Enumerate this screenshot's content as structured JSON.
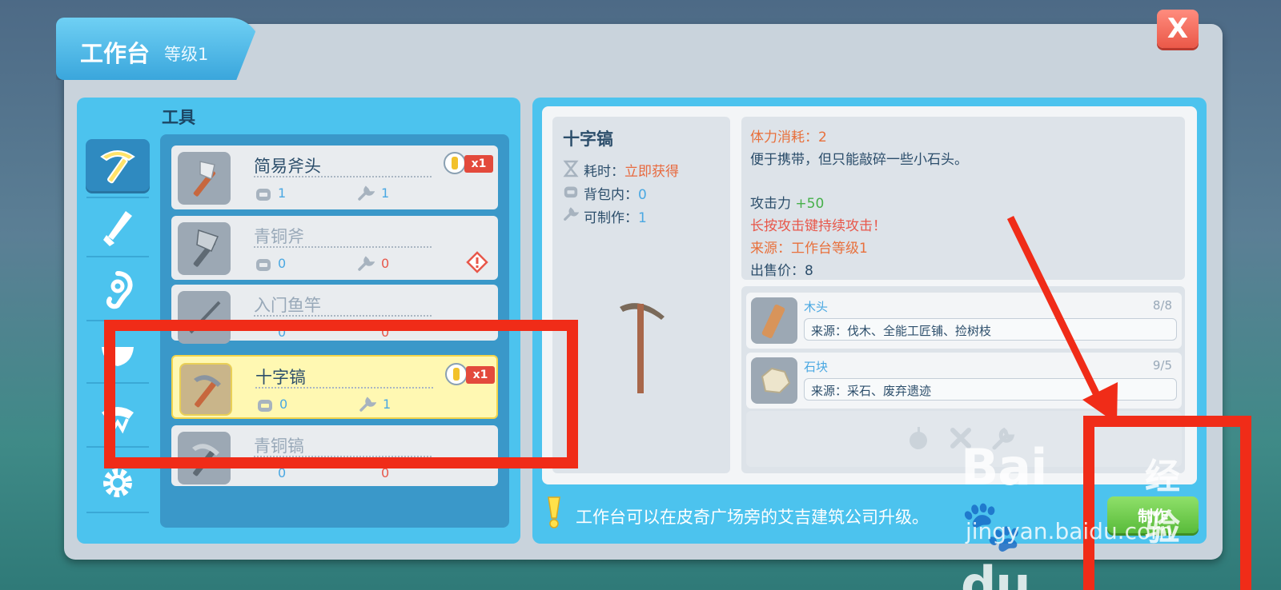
{
  "window": {
    "title": "工作台",
    "level": "等级1",
    "close_label": "X"
  },
  "category": {
    "label": "工具",
    "items": [
      {
        "icon": "pickaxe-icon",
        "active": true
      },
      {
        "icon": "sword-icon",
        "active": false
      },
      {
        "icon": "ear-icon",
        "active": false
      },
      {
        "icon": "bowl-icon",
        "active": false
      },
      {
        "icon": "ribbon-icon",
        "active": false
      },
      {
        "icon": "gear-icon",
        "active": false
      }
    ]
  },
  "tool_list": [
    {
      "name": "简易斧头",
      "bag": "1",
      "craftable": "1",
      "new": true,
      "count": "x1",
      "locked": false,
      "icon": "axe-icon"
    },
    {
      "name": "青铜斧",
      "bag": "0",
      "craftable": "0",
      "new": false,
      "locked": true,
      "icon": "bronze-axe-icon"
    },
    {
      "name": "入门鱼竿",
      "bag": "0",
      "craftable": "0",
      "new": false,
      "locked": true,
      "icon": "fishing-rod-icon"
    },
    {
      "name": "十字镐",
      "bag": "0",
      "craftable": "1",
      "new": true,
      "count": "x1",
      "locked": false,
      "selected": true,
      "icon": "pickaxe-icon"
    },
    {
      "name": "青铜镐",
      "bag": "0",
      "craftable": "0",
      "new": false,
      "locked": true,
      "icon": "bronze-pickaxe-icon"
    }
  ],
  "detail": {
    "name": "十字镐",
    "time_label": "耗时：",
    "time_value": "立即获得",
    "bag_label": "背包内：",
    "bag_value": "0",
    "craft_label": "可制作：",
    "craft_value": "1"
  },
  "description": {
    "stamina": "体力消耗：2",
    "desc": "便于携带，但只能敲碎一些小石头。",
    "attack_label": "攻击力 ",
    "attack_value": "+50",
    "hold_hint": "长按攻击键持续攻击！",
    "source": "来源：工作台等级1",
    "price": "出售价：8"
  },
  "materials": [
    {
      "name": "木头",
      "count": "8/8",
      "source": "来源：伐木、全能工匠铺、捡树枝",
      "icon": "wood-icon"
    },
    {
      "name": "石块",
      "count": "9/5",
      "source": "来源：采石、废弃遗迹",
      "icon": "stone-icon"
    }
  ],
  "hint": "工作台可以在皮奇广场旁的艾吉建筑公司升级。",
  "craft_button": "制作",
  "watermark": {
    "main": "Bai",
    "paw": "du",
    "cn": "经验",
    "url": "jingyan.baidu.com"
  },
  "colors": {
    "panel_blue": "#4cc3ee",
    "highlight_red": "#f02c18",
    "craft_green": "#59bb3a",
    "selected_yellow": "#fff8b2"
  }
}
